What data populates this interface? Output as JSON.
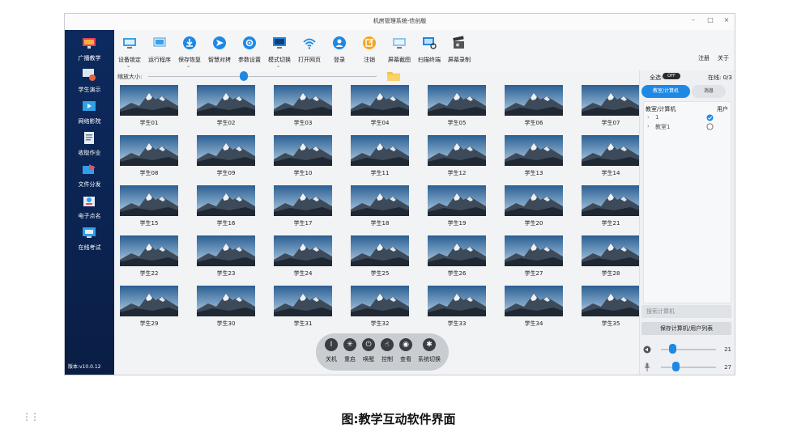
{
  "window": {
    "title": "机房管理系统-信创版"
  },
  "window_controls": {
    "minimize": "–",
    "maximize": "□",
    "close": "×"
  },
  "sidebar": {
    "items": [
      {
        "label": "广播教学",
        "icon": "broadcast-icon"
      },
      {
        "label": "学生演示",
        "icon": "student-demo-icon"
      },
      {
        "label": "网络影院",
        "icon": "cinema-icon"
      },
      {
        "label": "收取作业",
        "icon": "homework-icon"
      },
      {
        "label": "文件分发",
        "icon": "file-distribute-icon"
      },
      {
        "label": "电子点名",
        "icon": "rollcall-icon"
      },
      {
        "label": "在线考试",
        "icon": "exam-icon"
      }
    ],
    "version": "版本:v10.0.12"
  },
  "toolbar": {
    "items": [
      {
        "label": "设备锁定",
        "icon": "device-lock-icon",
        "dropdown": true
      },
      {
        "label": "运行程序",
        "icon": "run-program-icon",
        "dropdown": false
      },
      {
        "label": "保存恢复",
        "icon": "save-restore-icon",
        "dropdown": true
      },
      {
        "label": "智慧对拷",
        "icon": "smart-copy-icon",
        "dropdown": false
      },
      {
        "label": "参数设置",
        "icon": "settings-icon",
        "dropdown": false
      },
      {
        "label": "模式切换",
        "icon": "mode-switch-icon",
        "dropdown": true
      },
      {
        "label": "打开网页",
        "icon": "wifi-icon",
        "dropdown": false
      },
      {
        "label": "登录",
        "icon": "login-icon",
        "dropdown": false
      },
      {
        "label": "注销",
        "icon": "logout-icon",
        "dropdown": false
      },
      {
        "label": "屏幕截图",
        "icon": "screenshot-icon",
        "dropdown": false
      },
      {
        "label": "扫描终端",
        "icon": "scan-terminal-icon",
        "dropdown": false
      },
      {
        "label": "屏幕录制",
        "icon": "screen-record-icon",
        "dropdown": false
      }
    ],
    "register": "注册",
    "about": "关于"
  },
  "zoom": {
    "label": "缩放大小:",
    "level": 0.42
  },
  "students": [
    "学生01",
    "学生02",
    "学生03",
    "学生04",
    "学生05",
    "学生06",
    "学生07",
    "学生08",
    "学生09",
    "学生10",
    "学生11",
    "学生12",
    "学生13",
    "学生14",
    "学生15",
    "学生16",
    "学生17",
    "学生18",
    "学生19",
    "学生20",
    "学生21",
    "学生22",
    "学生23",
    "学生24",
    "学生25",
    "学生26",
    "学生27",
    "学生28",
    "学生29",
    "学生30",
    "学生31",
    "学生32",
    "学生33",
    "学生34",
    "学生35"
  ],
  "bottombar": {
    "items": [
      {
        "label": "关机",
        "glyph": "I",
        "icon": "power-off-icon"
      },
      {
        "label": "重启",
        "glyph": "✳",
        "icon": "restart-icon"
      },
      {
        "label": "唤醒",
        "glyph": "⏻",
        "icon": "wake-icon"
      },
      {
        "label": "控制",
        "glyph": "☝",
        "icon": "control-icon"
      },
      {
        "label": "查看",
        "glyph": "◉",
        "icon": "view-icon"
      },
      {
        "label": "系统切换",
        "glyph": "✱",
        "icon": "system-switch-icon"
      }
    ]
  },
  "right_panel": {
    "select_all": "全选:",
    "toggle_text": "OFF",
    "online": "在线: 0/3",
    "tabs": [
      "教室/计算机",
      "消息"
    ],
    "columns": [
      "教室/计算机",
      "用户"
    ],
    "tree": [
      {
        "label": "1",
        "checked": true
      },
      {
        "label": "教室1",
        "checked": false
      }
    ],
    "search_placeholder": "搜索计算机",
    "save_button": "保存计算机/用户列表",
    "speaker_volume": 21,
    "mic_volume": 27
  },
  "caption": "图:教学互动软件界面",
  "colors": {
    "accent": "#1e88e5",
    "sidebar": "#0c2a5e"
  }
}
